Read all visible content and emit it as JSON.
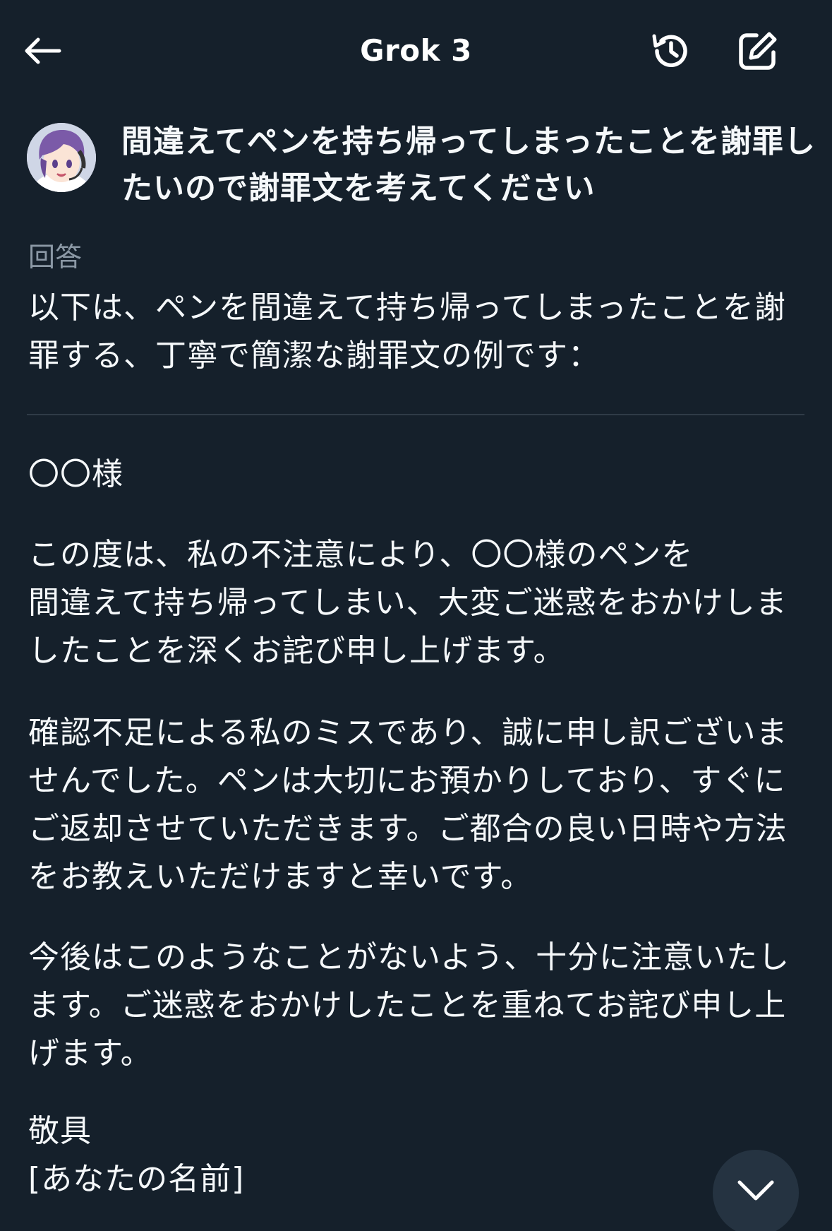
{
  "header": {
    "title": "Grok 3",
    "back_icon": "arrow-left-icon",
    "history_icon": "history-icon",
    "compose_icon": "compose-icon"
  },
  "user_message": {
    "avatar": "user-avatar",
    "text": "間違えてペンを持ち帰ってしまったことを謝罪したいので謝罪文を考えてください"
  },
  "answer": {
    "label": "回答",
    "intro": "以下は、ペンを間違えて持ち帰ってしまったことを謝罪する、丁寧で簡潔な謝罪文の例です：",
    "salutation": "〇〇様",
    "para1": "この度は、私の不注意により、〇〇様のペンを\n間違えて持ち帰ってしまい、大変ご迷惑をおかけしましたことを深くお詫び申し上げます。",
    "para2": "確認不足による私のミスであり、誠に申し訳ございませんでした。ペンは大切にお預かりしており、すぐにご返却させていただきます。ご都合の良い日時や方法をお教えいただけますと幸いです。",
    "para3": "今後はこのようなことがないよう、十分に注意いたします。ご迷惑をおかけしたことを重ねてお詫び申し上げます。",
    "closing": "敬具",
    "signature": "[あなたの名前]"
  },
  "scroll_button": {
    "icon": "chevron-down-icon"
  },
  "colors": {
    "background": "#15202b",
    "text": "#f5f8fa",
    "muted": "#8b98a5",
    "divider": "#2f3b47",
    "scroll_button": "#253341"
  }
}
